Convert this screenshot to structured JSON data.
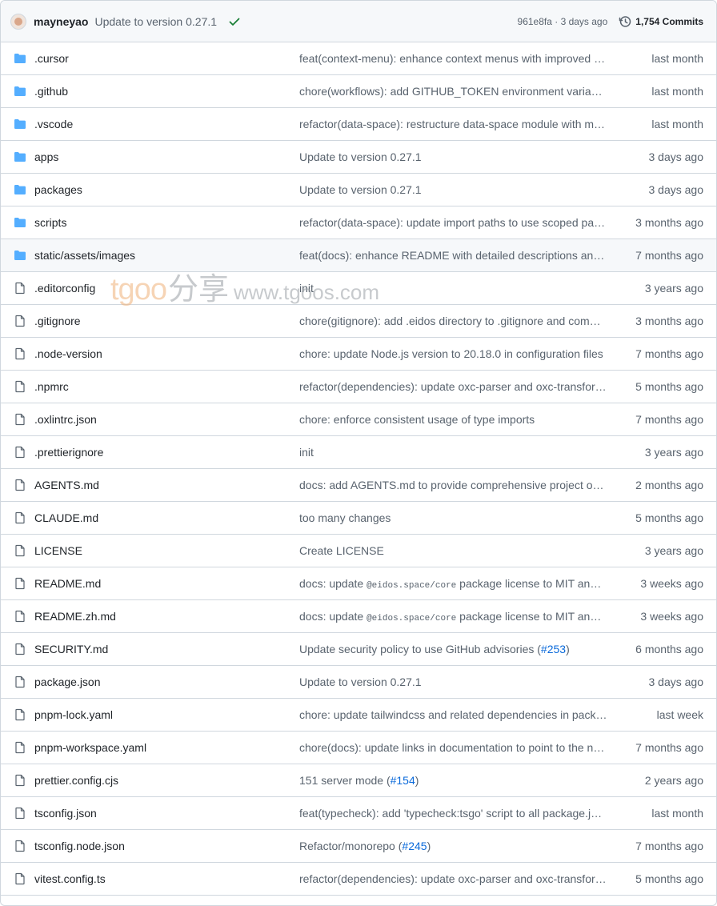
{
  "latest_commit": {
    "author": "mayneyao",
    "message": "Update to version 0.27.1",
    "status_icon": "check-icon",
    "sha_time": "961e8fa · 3 days ago",
    "commits_count": "1,754 Commits"
  },
  "colors": {
    "folder": "#54aeff",
    "file_icon": "#59636e",
    "check": "#1a7f37",
    "link": "#0969da"
  },
  "watermark": {
    "logo": "tgoo",
    "sub": "分享",
    "url": "www.tgoos.com"
  },
  "rows": [
    {
      "type": "folder",
      "name": ".cursor",
      "message": "feat(context-menu): enhance context menus with improved action handling and styling",
      "age": "last month"
    },
    {
      "type": "folder",
      "name": ".github",
      "message": "chore(workflows): add GITHUB_TOKEN environment variable to workflows",
      "age": "last month"
    },
    {
      "type": "folder",
      "name": ".vscode",
      "message": "refactor(data-space): restructure data-space module with multiple packages",
      "age": "last month"
    },
    {
      "type": "folder",
      "name": "apps",
      "message": "Update to version 0.27.1",
      "age": "3 days ago"
    },
    {
      "type": "folder",
      "name": "packages",
      "message": "Update to version 0.27.1",
      "age": "3 days ago"
    },
    {
      "type": "folder",
      "name": "scripts",
      "message": "refactor(data-space): update import paths to use scoped packages",
      "age": "3 months ago"
    },
    {
      "type": "folder",
      "name": "static/assets/images",
      "message": "feat(docs): enhance README with detailed descriptions and screenshots",
      "age": "7 months ago",
      "highlight": true
    },
    {
      "type": "file",
      "name": ".editorconfig",
      "message": "init",
      "age": "3 years ago"
    },
    {
      "type": "file",
      "name": ".gitignore",
      "message": "chore(gitignore): add .eidos directory to .gitignore and commit changes",
      "age": "3 months ago"
    },
    {
      "type": "file",
      "name": ".node-version",
      "message": "chore: update Node.js version to 20.18.0 in configuration files",
      "age": "7 months ago"
    },
    {
      "type": "file",
      "name": ".npmrc",
      "message": "refactor(dependencies): update oxc-parser and oxc-transform versions",
      "age": "5 months ago"
    },
    {
      "type": "file",
      "name": ".oxlintrc.json",
      "message": "chore: enforce consistent usage of type imports",
      "age": "7 months ago"
    },
    {
      "type": "file",
      "name": ".prettierignore",
      "message": "init",
      "age": "3 years ago"
    },
    {
      "type": "file",
      "name": "AGENTS.md",
      "message": "docs: add AGENTS.md to provide comprehensive project overview",
      "age": "2 months ago"
    },
    {
      "type": "file",
      "name": "CLAUDE.md",
      "message": "too many changes",
      "age": "5 months ago"
    },
    {
      "type": "file",
      "name": "LICENSE",
      "message": "Create LICENSE",
      "age": "3 years ago"
    },
    {
      "type": "file",
      "name": "README.md",
      "message_pre": "docs: update ",
      "message_code": "@eidos.space/core",
      "message_post": " package license to MIT and update documentation",
      "age": "3 weeks ago"
    },
    {
      "type": "file",
      "name": "README.zh.md",
      "message_pre": "docs: update ",
      "message_code": "@eidos.space/core",
      "message_post": " package license to MIT and update documentation",
      "age": "3 weeks ago"
    },
    {
      "type": "file",
      "name": "SECURITY.md",
      "message_pre": "Update security policy to use GitHub advisories (",
      "message_link": "#253",
      "message_post": ")",
      "age": "6 months ago"
    },
    {
      "type": "file",
      "name": "package.json",
      "message": "Update to version 0.27.1",
      "age": "3 days ago"
    },
    {
      "type": "file",
      "name": "pnpm-lock.yaml",
      "message": "chore: update tailwindcss and related dependencies in package.json",
      "age": "last week"
    },
    {
      "type": "file",
      "name": "pnpm-workspace.yaml",
      "message": "chore(docs): update links in documentation to point to the new site",
      "age": "7 months ago"
    },
    {
      "type": "file",
      "name": "prettier.config.cjs",
      "message_pre": "151 server mode (",
      "message_link": "#154",
      "message_post": ")",
      "age": "2 years ago"
    },
    {
      "type": "file",
      "name": "tsconfig.json",
      "message": "feat(typecheck): add 'typecheck:tsgo' script to all package.json files",
      "age": "last month"
    },
    {
      "type": "file",
      "name": "tsconfig.node.json",
      "message_pre": "Refactor/monorepo (",
      "message_link": "#245",
      "message_post": ")",
      "age": "7 months ago"
    },
    {
      "type": "file",
      "name": "vitest.config.ts",
      "message": "refactor(dependencies): update oxc-parser and oxc-transform versions",
      "age": "5 months ago"
    }
  ]
}
